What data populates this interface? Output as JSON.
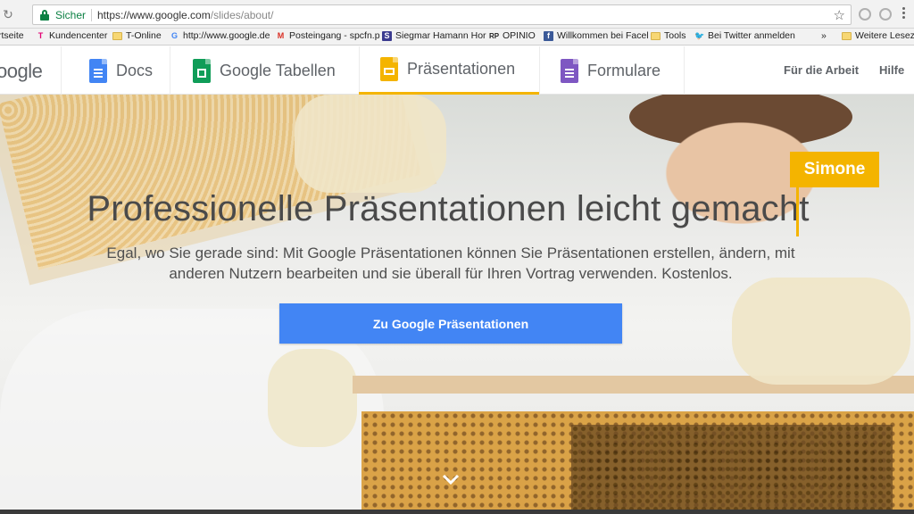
{
  "browser": {
    "secure_label": "Sicher",
    "url_main": "https://www.google.com",
    "url_path": "/slides/about/",
    "overflow_label": "»",
    "other_bookmarks": "Weitere Lesezeichen"
  },
  "bookmarks": [
    {
      "label": "rtseite",
      "icon": "folder-icon"
    },
    {
      "label": "Kundencenter",
      "icon": "telekom-icon"
    },
    {
      "label": "T-Online",
      "icon": "folder-icon"
    },
    {
      "label": "http://www.google.de",
      "icon": "google-g-icon"
    },
    {
      "label": "Posteingang - spcfn.p",
      "icon": "gmail-icon"
    },
    {
      "label": "Siegmar Hamann Hor",
      "icon": "sh-icon"
    },
    {
      "label": "OPINIO",
      "icon": "rp-icon"
    },
    {
      "label": "Willkommen bei Facel",
      "icon": "facebook-icon"
    },
    {
      "label": "Tools",
      "icon": "folder-icon"
    },
    {
      "label": "Bei Twitter anmelden",
      "icon": "twitter-icon"
    }
  ],
  "header": {
    "logo": "oogle",
    "tabs": [
      {
        "label": "Docs",
        "color": "#4285f4"
      },
      {
        "label": "Google Tabellen",
        "color": "#0f9d58"
      },
      {
        "label": "Präsentationen",
        "color": "#f4b400"
      },
      {
        "label": "Formulare",
        "color": "#7e57c2"
      }
    ],
    "links": {
      "business": "Für die Arbeit",
      "help": "Hilfe"
    }
  },
  "hero": {
    "title": "Professionelle Präsentationen leicht gemacht",
    "subtitle": "Egal, wo Sie gerade sind: Mit Google Präsentationen können Sie Präsentationen erstellen, ändern, mit anderen Nutzern bearbeiten und sie überall für Ihren Vortrag verwenden. Kostenlos.",
    "cta_label": "Zu Google Präsentationen",
    "collaborator_tag": "Simone"
  },
  "colors": {
    "accent_blue": "#4285f4",
    "slides_yellow": "#f4b400",
    "secure_green": "#0b8043"
  }
}
